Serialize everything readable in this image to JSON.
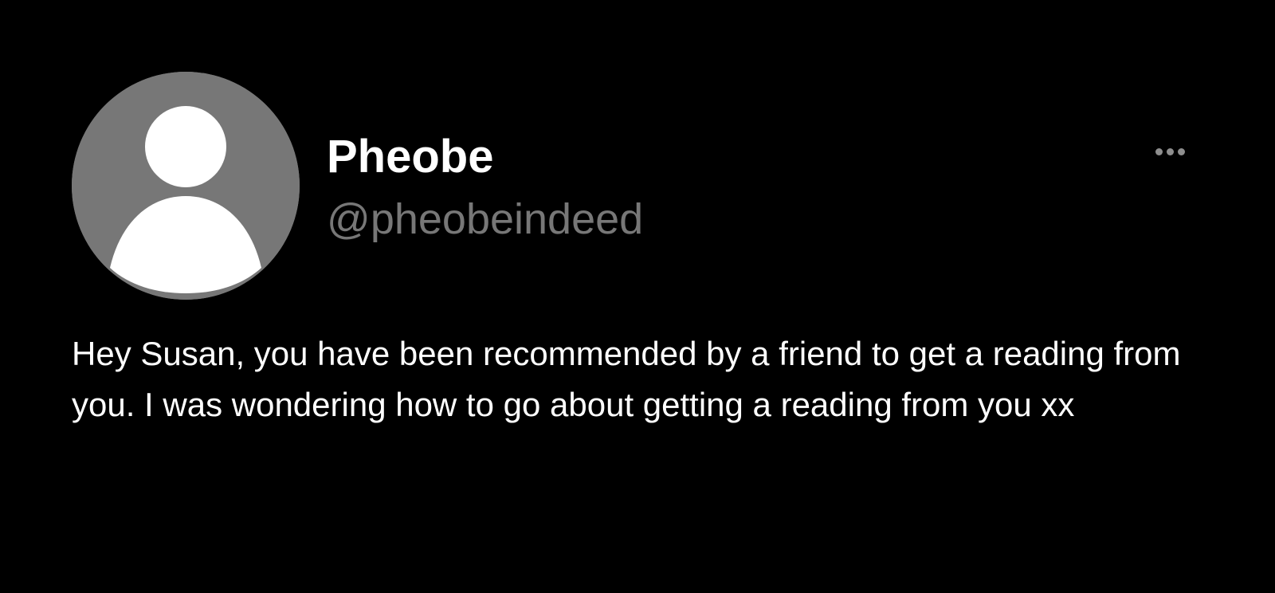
{
  "post": {
    "author": {
      "display_name": "Pheobe",
      "handle": "@pheobeindeed",
      "avatar_icon": "default-user-avatar-icon"
    },
    "more_icon": "ellipsis-horizontal-icon",
    "message": "Hey Susan, you have been recommended by a friend to get a reading from you. I was wondering how to go about getting a reading from you xx"
  },
  "colors": {
    "background": "#000000",
    "text_primary": "#ffffff",
    "text_secondary": "#777777",
    "avatar_bg": "#777777",
    "icon_muted": "#8e8e8e"
  }
}
